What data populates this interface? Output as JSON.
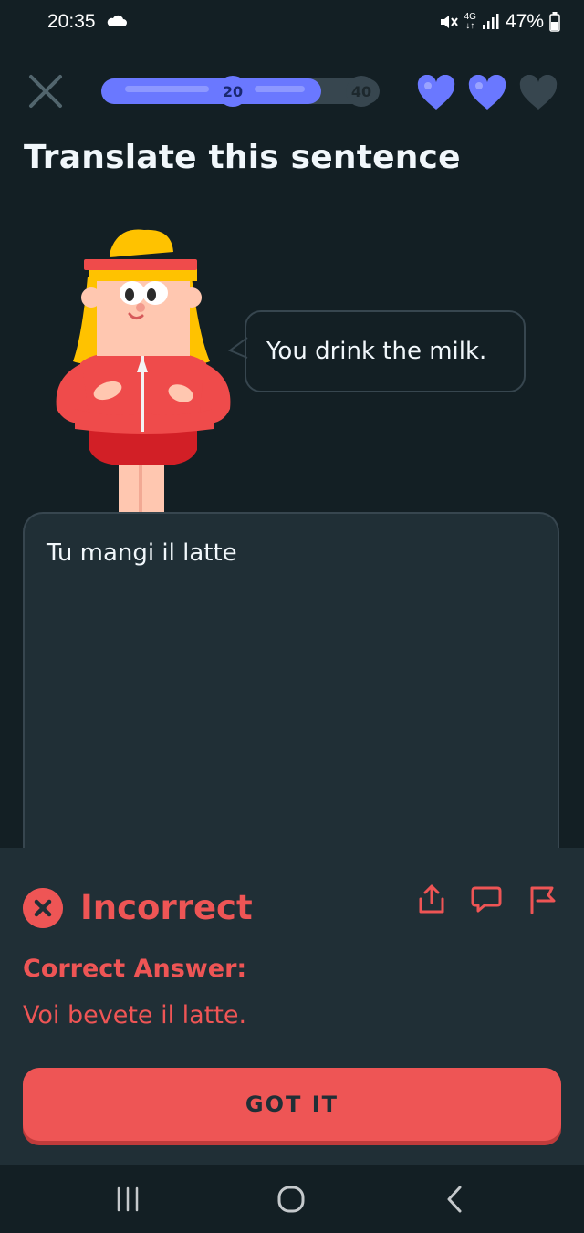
{
  "status_bar": {
    "time": "20:35",
    "network": "4G",
    "battery": "47%",
    "icons": [
      "cloud-icon",
      "mute-icon",
      "signal-icon",
      "battery-icon"
    ]
  },
  "lesson": {
    "progress_fraction": 0.79,
    "milestones": [
      "20",
      "40"
    ],
    "hearts": {
      "full": 2,
      "empty": 1
    },
    "accent_color": "#6a78ff"
  },
  "prompt": {
    "title": "Translate this sentence",
    "sentence": "You drink the milk."
  },
  "answer": {
    "user_input": "Tu mangi il latte"
  },
  "feedback": {
    "status": "Incorrect",
    "correct_label": "Correct Answer:",
    "correct_answer": "Voi bevete il latte.",
    "button_label": "GOT IT",
    "color": "#ee5555",
    "icons": [
      "share-icon",
      "comment-icon",
      "flag-icon"
    ]
  },
  "system_nav": {
    "icons": [
      "recents-icon",
      "home-icon",
      "back-icon"
    ]
  }
}
